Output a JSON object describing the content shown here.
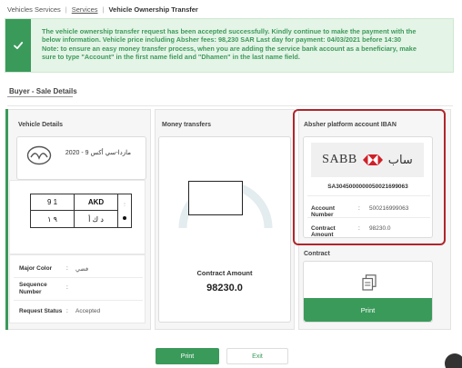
{
  "breadcrumb": {
    "home": "Vehicles Services",
    "services": "Services",
    "current": "Vehicle Ownership Transfer"
  },
  "alert": {
    "line1": "The vehicle ownership transfer request has been accepted successfully. Kindly continue to make the payment with the",
    "line2": "below information. Vehicle price including Absher fees: 98,230 SAR Last day for payment: 04/03/2021 before 14:30",
    "line3": "Note: to ensure an easy money transfer process, when you are adding the service bank account as a beneficiary, make",
    "line4": "sure to type \"Account\" in the first name field and \"Dhamen\" in the last name field."
  },
  "section": {
    "title": "Buyer - Sale Details"
  },
  "vehicle": {
    "title": "Vehicle Details",
    "name": "مازدا-سي أكس 9 - 2020",
    "plate": {
      "num_en": "9 1",
      "letters_en": "AKD",
      "num_ar": "٩ ١",
      "letters_ar": "د ك أ"
    },
    "rows": [
      {
        "key": "Major Color",
        "value": "فضي"
      },
      {
        "key": "Sequence Number",
        "value": ""
      },
      {
        "key": "Request Status",
        "value": "Accepted"
      }
    ]
  },
  "money": {
    "title": "Money transfers",
    "contract_label": "Contract Amount",
    "contract_amount": "98230.0"
  },
  "iban": {
    "title": "Absher platform account IBAN",
    "bank_en": "SABB",
    "bank_ar": "ساب",
    "number": "SA3045000000050021699063",
    "account_number_label": "Account Number",
    "account_number": "500216999063",
    "contract_amount_label": "Contract Amount",
    "contract_amount": "98230.0"
  },
  "contract": {
    "title": "Contract",
    "print_label": "Print"
  },
  "actions": {
    "print_label": "Print",
    "exit_label": "Exit"
  },
  "colors": {
    "accent": "#3a9a5a",
    "highlight": "#b0252c",
    "alert_bg": "#e4f4e7"
  }
}
